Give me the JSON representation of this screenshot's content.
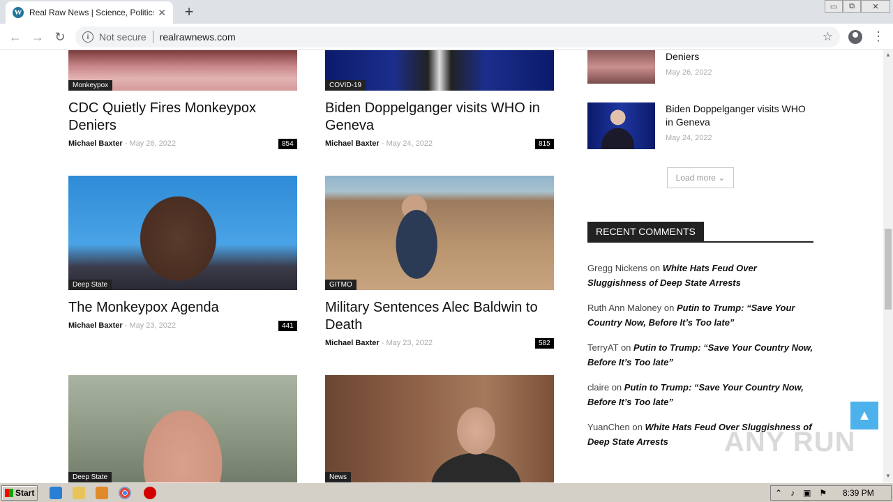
{
  "browser": {
    "tab_title": "Real Raw News | Science, Politics, C",
    "tab_close": "✕",
    "new_tab": "+",
    "security_label": "Not secure",
    "url": "realrawnews.com",
    "window_controls": [
      "▭",
      "⧉",
      "✕"
    ]
  },
  "articles": [
    {
      "category": "Monkeypox",
      "title": "CDC Quietly Fires Monkeypox Deniers",
      "author": "Michael Baxter",
      "date": "May 26, 2022",
      "comments": "854"
    },
    {
      "category": "COVID-19",
      "title": "Biden Doppelganger visits WHO in Geneva",
      "author": "Michael Baxter",
      "date": "May 24, 2022",
      "comments": "815"
    },
    {
      "category": "Deep State",
      "title": "The Monkeypox Agenda",
      "author": "Michael Baxter",
      "date": "May 23, 2022",
      "comments": "441"
    },
    {
      "category": "GITMO",
      "title": "Military Sentences Alec Baldwin to Death",
      "author": "Michael Baxter",
      "date": "May 23, 2022",
      "comments": "582"
    },
    {
      "category": "Deep State"
    },
    {
      "category": "News"
    }
  ],
  "meta_separator": "-",
  "sidebar": {
    "items": [
      {
        "title": "Deniers",
        "date": "May 26, 2022"
      },
      {
        "title": "Biden Doppelganger visits WHO in Geneva",
        "date": "May 24, 2022"
      }
    ],
    "load_more": "Load more ⌄",
    "recent_comments_heading": "RECENT COMMENTS",
    "comments": [
      {
        "author": "Gregg Nickens",
        "on": "on",
        "post": "White Hats Feud Over Sluggishness of Deep State Arrests"
      },
      {
        "author": "Ruth Ann Maloney",
        "on": "on",
        "post": "Putin to Trump: “Save Your Country Now, Before It’s Too late”"
      },
      {
        "author": "TerryAT",
        "on": "on",
        "post": "Putin to Trump: “Save Your Country Now, Before It’s Too late”"
      },
      {
        "author": "claire",
        "on": "on",
        "post": "Putin to Trump: “Save Your Country Now, Before It’s Too late”"
      },
      {
        "author": "YuanChen",
        "on": "on",
        "post": "White Hats Feud Over Sluggishness of Deep State Arrests"
      }
    ]
  },
  "watermark": "ANY RUN",
  "taskbar": {
    "start_label": "Start",
    "clock": "8:39 PM"
  },
  "colors": {
    "accent": "#4db2ec",
    "category_bg": "#222222",
    "tab_strip": "#dee1e6"
  }
}
